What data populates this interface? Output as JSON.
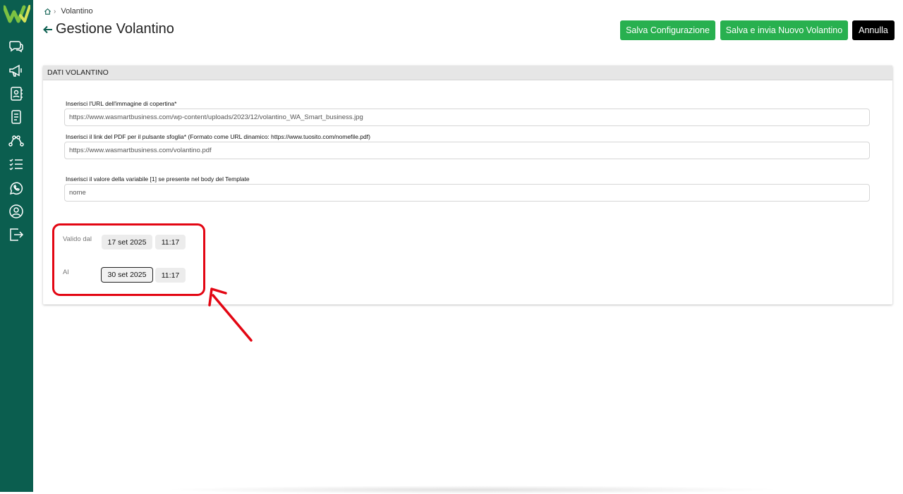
{
  "sidebar": {
    "logo": "W",
    "items": [
      {
        "icon": "chat-icon"
      },
      {
        "icon": "megaphone-icon"
      },
      {
        "icon": "contacts-icon"
      },
      {
        "icon": "document-icon"
      },
      {
        "icon": "flow-icon"
      },
      {
        "icon": "checklist-icon"
      },
      {
        "icon": "whatsapp-icon"
      },
      {
        "icon": "user-icon"
      },
      {
        "icon": "logout-icon"
      }
    ],
    "color": "#0b5e4f"
  },
  "breadcrumb": {
    "home_icon": "home-icon",
    "current": "Volantino"
  },
  "page": {
    "title": "Gestione Volantino"
  },
  "toolbar": {
    "save_label": "Salva Configurazione",
    "save_send_label": "Salva e invia Nuovo Volantino",
    "cancel_label": "Annulla"
  },
  "card": {
    "header": "DATI VOLANTINO",
    "fields": [
      {
        "label": "Inserisci l'URL dell'immagine di copertina*",
        "value": "https://www.wasmartbusiness.com/wp-content/uploads/2023/12/volantino_WA_Smart_business.jpg"
      },
      {
        "label": "Inserisci il link del PDF per il pulsante sfoglia* (Formato come URL dinamico: https://www.tuosito.com/nomefile.pdf)",
        "value": "https://www.wasmartbusiness.com/volantino.pdf"
      },
      {
        "label": "Inserisci il valore della variabile [1] se presente nel body del Template",
        "value": "nome"
      }
    ],
    "validity": {
      "from_label": "Valido dal",
      "from_date": "17 set 2025",
      "from_time": "11:17",
      "to_label": "Al",
      "to_date": "30 set 2025",
      "to_time": "11:17"
    }
  },
  "colors": {
    "accent": "#28b04f",
    "highlight": "#e30613"
  }
}
